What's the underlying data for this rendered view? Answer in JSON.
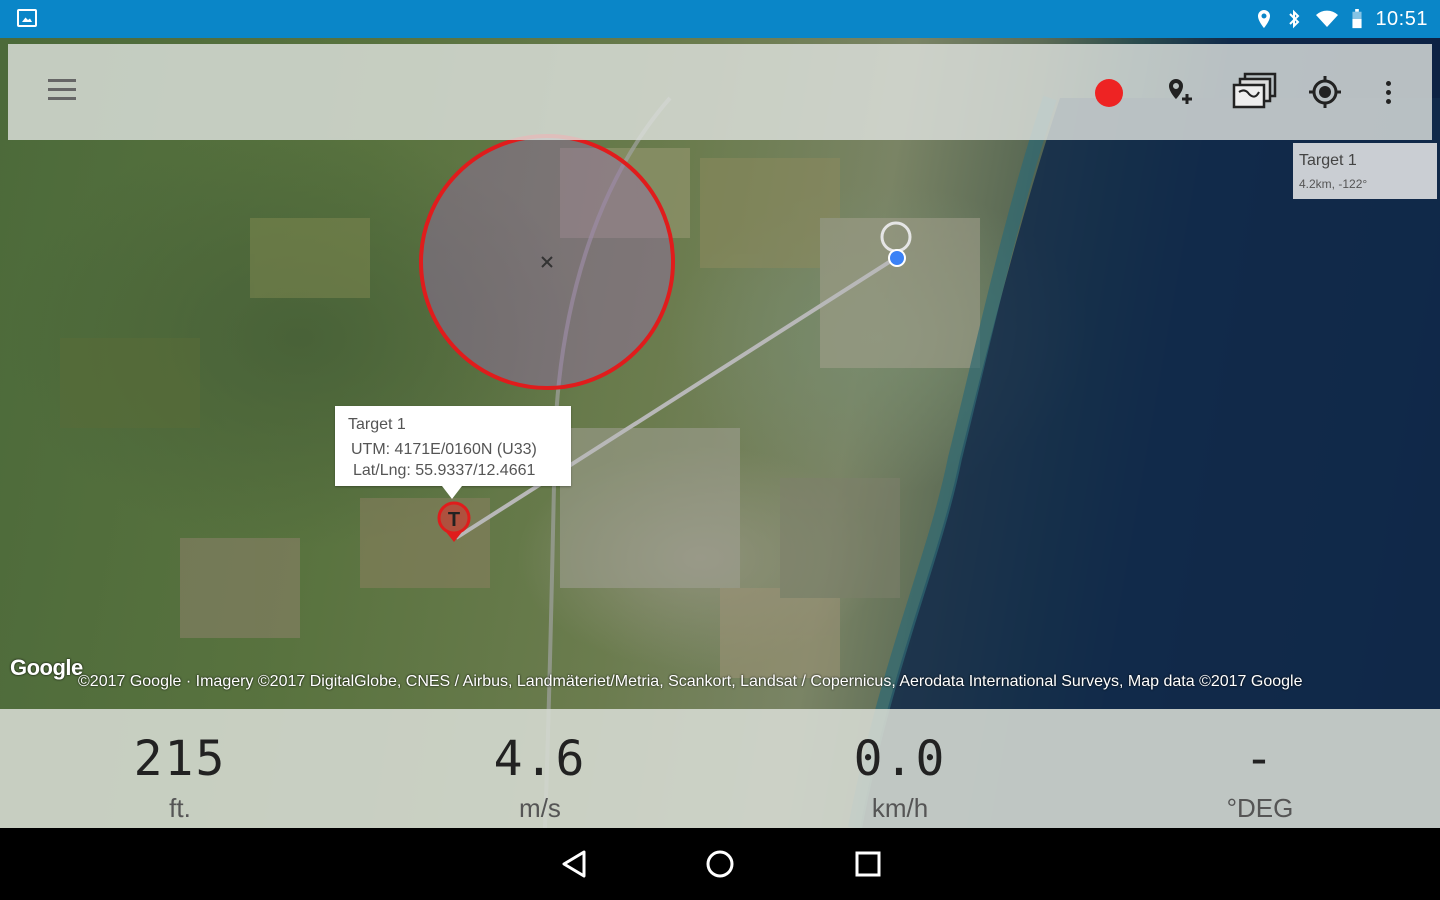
{
  "status_bar": {
    "time": "10:51",
    "left_icon": "image-icon",
    "right_icons": [
      "location-icon",
      "bluetooth-icon",
      "wifi-icon",
      "battery-icon"
    ]
  },
  "toolbar": {
    "menu_icon": "hamburger-menu-icon",
    "record_icon": "record-icon",
    "add_marker_icon": "add-location-icon",
    "map_layers_icon": "map-layers-icon",
    "locate_icon": "my-location-icon",
    "overflow_icon": "more-vert-icon",
    "colors": {
      "record": "#ee2323",
      "statusbar": "#0a86c8"
    }
  },
  "target_summary": {
    "name": "Target 1",
    "detail": "4.2km, -122°"
  },
  "target_callout": {
    "title": "Target 1",
    "utm": "UTM: 4171E/0160N (U33)",
    "latlng": "Lat/Lng: 55.9337/12.4661"
  },
  "map": {
    "marker_label": "T",
    "logo": "Google",
    "attribution": "©2017 Google · Imagery ©2017 DigitalGlobe, CNES / Airbus, Landmäteriet/Metria, Scankort, Landsat / Copernicus, Aerodata International Surveys, Map data ©2017 Google"
  },
  "stats": [
    {
      "value": "215",
      "unit": "ft."
    },
    {
      "value": "4.6",
      "unit": "m/s"
    },
    {
      "value": "0.0",
      "unit": "km/h"
    },
    {
      "value": "-",
      "unit": "°DEG"
    }
  ],
  "nav_bar": {
    "back_icon": "back-icon",
    "home_icon": "home-icon",
    "recents_icon": "recents-icon"
  }
}
